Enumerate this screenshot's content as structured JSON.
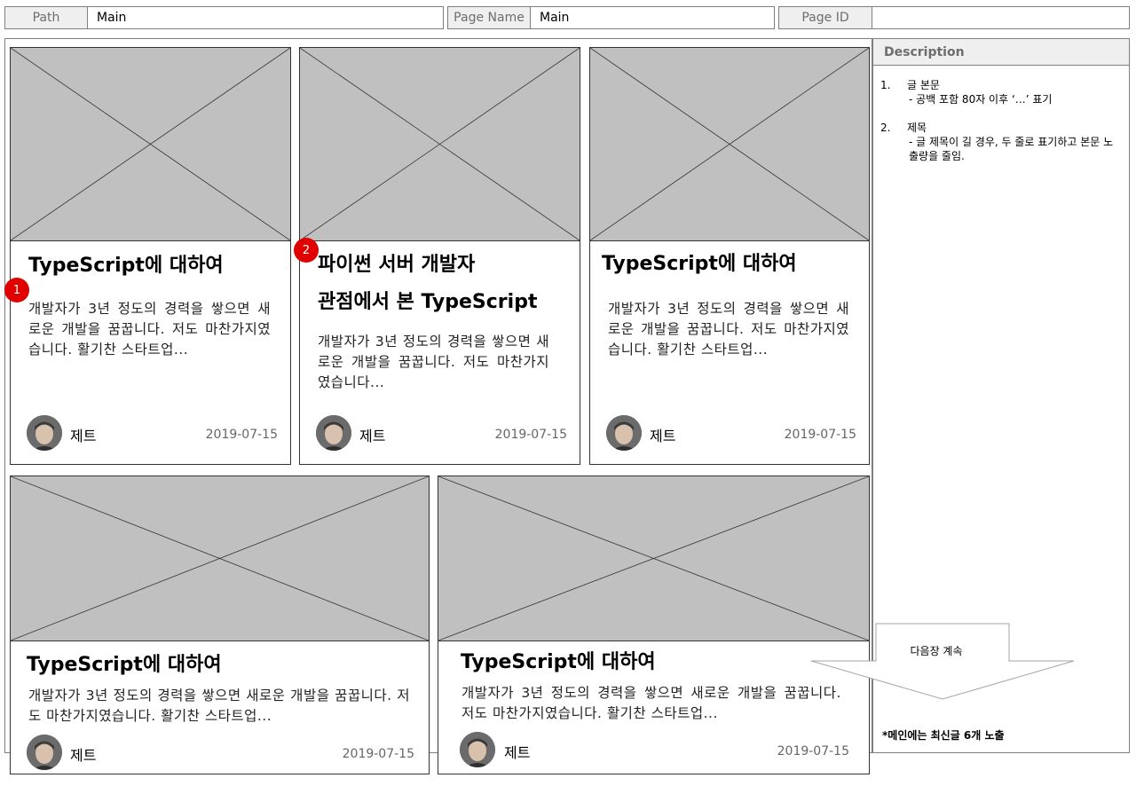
{
  "header": {
    "path_label": "Path",
    "path_value": "Main",
    "page_name_label": "Page Name",
    "page_name_value": "Main",
    "page_id_label": "Page ID",
    "page_id_value": ""
  },
  "cards": [
    {
      "title_lines": [
        "TypeScript에 대하여"
      ],
      "body": "개발자가 3년 정도의 경력을 쌓으면 새로운 개발을 꿈꿉니다. 저도 마찬가지였습니다. 활기찬 스타트업...",
      "author": "제트",
      "date": "2019-07-15"
    },
    {
      "title_lines": [
        "파이썬 서버 개발자",
        "관점에서 본 TypeScript"
      ],
      "body": "개발자가 3년 정도의 경력을 쌓으면 새로운 개발을 꿈꿉니다. 저도 마찬가지였습니다...",
      "author": "제트",
      "date": "2019-07-15"
    },
    {
      "title_lines": [
        "TypeScript에 대하여"
      ],
      "body": "개발자가 3년 정도의 경력을 쌓으면 새로운 개발을 꿈꿉니다. 저도 마찬가지였습니다. 활기찬 스타트업...",
      "author": "제트",
      "date": "2019-07-15"
    },
    {
      "title_lines": [
        "TypeScript에 대하여"
      ],
      "body": "개발자가 3년 정도의 경력을 쌓으면 새로운 개발을 꿈꿉니다. 저도 마찬가지였습니다. 활기찬 스타트업...",
      "author": "제트",
      "date": "2019-07-15"
    },
    {
      "title_lines": [
        "TypeScript에 대하여"
      ],
      "body": "개발자가 3년 정도의 경력을 쌓으면 새로운 개발을 꿈꿉니다. 저도 마찬가지였습니다. 활기찬 스타트업...",
      "author": "제트",
      "date": "2019-07-15"
    }
  ],
  "badges": [
    "1",
    "2"
  ],
  "description": {
    "title": "Description",
    "items": [
      {
        "num": "1.",
        "lines": [
          "글 본문",
          "- 공백 포함 80자 이후 ‘…’ 표기"
        ]
      },
      {
        "num": "2.",
        "lines": [
          "제목",
          "- 글 제목이 길 경우, 두 줄로 표기하고 본문 노출량을 줄임."
        ]
      }
    ],
    "next_label": "다음장 계속",
    "note": "*메인에는 최신글 6개 노출"
  },
  "colors": {
    "badge": "#e00000",
    "placeholder": "#c0c0c0",
    "header_bg": "#efefef"
  },
  "icons": {
    "avatar": "avatar-photo",
    "placeholder": "image-placeholder-x"
  }
}
